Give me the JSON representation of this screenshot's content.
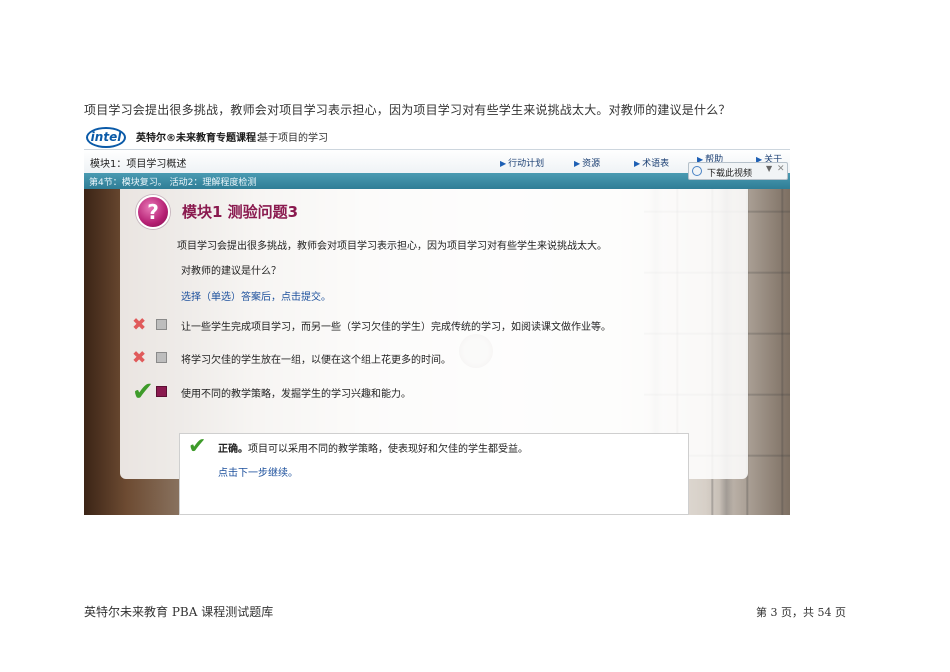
{
  "document": {
    "question_text": "项目学习会提出很多挑战，教师会对项目学习表示担心，因为项目学习对有些学生来说挑战太大。对教师的建议是什么？",
    "footer_left": "英特尔未来教育 PBA 课程测试题库",
    "footer_right": "第 3 页，共 54 页"
  },
  "app": {
    "logo_text": "intel",
    "course_label": "英特尔®未来教育专题课程：",
    "course_name": "基于项目的学习",
    "module_title": "模块1：项目学习概述",
    "nav": [
      "行动计划",
      "资源",
      "术语表",
      "帮助",
      "关于"
    ],
    "download_label": "下载此视频",
    "lesson_bar": "第4节：模块复习。 活动2：理解程度检测"
  },
  "quiz": {
    "badge": "?",
    "title": "模块1 测验问题3",
    "prompt_line1": "项目学习会提出很多挑战，教师会对项目学习表示担心，因为项目学习对有些学生来说挑战太大。",
    "prompt_line2": "对教师的建议是什么？",
    "hint": "选择（单选）答案后，点击提交。",
    "options": [
      {
        "text": "让一些学生完成项目学习，而另一些（学习欠佳的学生）完成传统的学习，如阅读课文做作业等。",
        "status": "wrong"
      },
      {
        "text": "将学习欠佳的学生放在一组，以便在这个组上花更多的时间。",
        "status": "wrong"
      },
      {
        "text": "使用不同的教学策略，发掘学生的学习兴趣和能力。",
        "status": "correct"
      }
    ],
    "feedback_label": "正确。",
    "feedback_text": "项目可以采用不同的教学策略，使表现好和欠佳的学生都受益。",
    "next_link": "点击下一步继续。"
  },
  "colors": {
    "accent": "#8a1a4f",
    "lesson_bar": "#2f7d96",
    "link": "#1b4f9c",
    "correct": "#3e9b2a",
    "wrong": "#e05a5a"
  }
}
